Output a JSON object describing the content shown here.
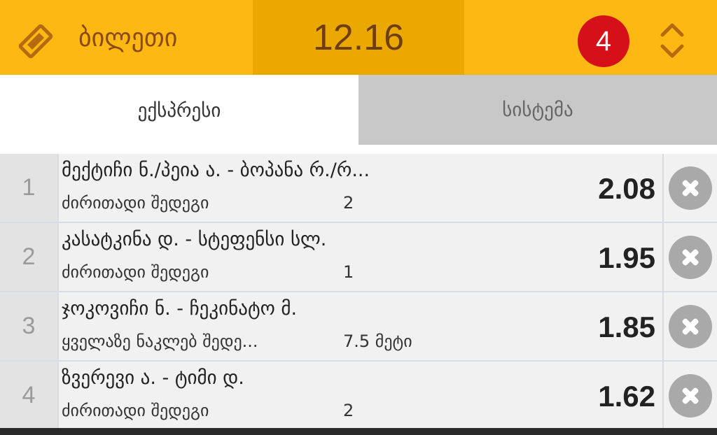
{
  "colors": {
    "header": "#fdb813",
    "total_box": "#eba800",
    "badge": "#d51018",
    "tab_inactive": "#c8c8c8"
  },
  "header": {
    "icon": "ticket-icon",
    "title": "ბილეთი",
    "total": "12.16",
    "count": "4",
    "toggle_icon": "expand-collapse-icon"
  },
  "tabs": [
    {
      "label": "ექსპრესი",
      "active": true
    },
    {
      "label": "სისტემა",
      "active": false
    }
  ],
  "bets": [
    {
      "num": "1",
      "match": "მექტიჩი ნ./პეია ა. - ბოპანა რ./რ...",
      "market": "ძირითადი შედეგი",
      "selection": "2",
      "odds": "2.08"
    },
    {
      "num": "2",
      "match": "კასატკინა დ. - სტეფენსი სლ.",
      "market": "ძირითადი შედეგი",
      "selection": "1",
      "odds": "1.95"
    },
    {
      "num": "3",
      "match": "ჯოკოვიჩი ნ. - ჩეკინატო მ.",
      "market": "ყველაზე ნაკლებ შედე...",
      "selection": "7.5 მეტი",
      "odds": "1.85"
    },
    {
      "num": "4",
      "match": "ზვერევი ა. - ტიმი დ.",
      "market": "ძირითადი შედეგი",
      "selection": "2",
      "odds": "1.62"
    }
  ]
}
